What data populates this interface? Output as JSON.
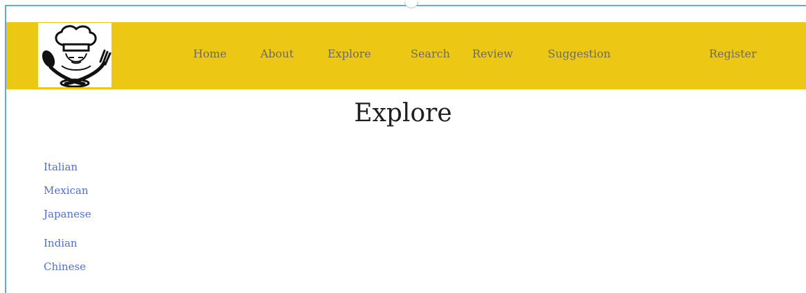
{
  "nav": {
    "logo_icon": "chef-hat-spoon-fork-icon",
    "links": [
      {
        "label": "Home"
      },
      {
        "label": "About"
      },
      {
        "label": "Explore"
      },
      {
        "label": "Search"
      },
      {
        "label": "Review"
      },
      {
        "label": "Suggestion"
      },
      {
        "label": "Register"
      }
    ]
  },
  "page": {
    "title": "Explore"
  },
  "cuisines": [
    {
      "label": "Italian"
    },
    {
      "label": "Mexican"
    },
    {
      "label": "Japanese"
    },
    {
      "label": "Indian"
    },
    {
      "label": "Chinese"
    }
  ],
  "colors": {
    "navbar": "#ecc713",
    "nav_text": "#6d6a64",
    "link": "#4f6de0",
    "frame_border": "#6aa6e6"
  }
}
